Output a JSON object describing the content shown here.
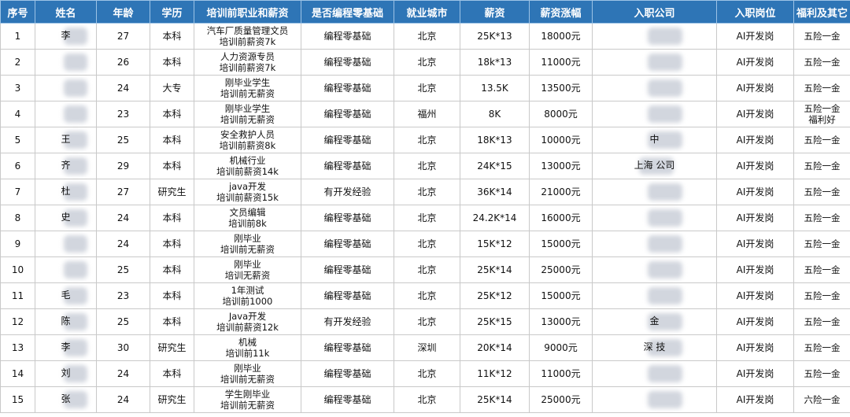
{
  "headers": {
    "index": "序号",
    "name": "姓名",
    "age": "年龄",
    "education": "学历",
    "prev_job": "培训前职业和薪资",
    "zero_base": "是否编程零基础",
    "city": "就业城市",
    "salary": "薪资",
    "raise": "薪资涨幅",
    "company": "入职公司",
    "position": "入职岗位",
    "benefits": "福利及其它"
  },
  "rows": [
    {
      "index": "1",
      "name": "李",
      "age": "27",
      "education": "本科",
      "prev_job": [
        "汽车厂质量管理文员",
        "培训前薪资7k"
      ],
      "zero_base": "编程零基础",
      "city": "北京",
      "salary": "25K*13",
      "raise": "18000元",
      "company": "",
      "position": "AI开发岗",
      "benefits": [
        "五险一金"
      ]
    },
    {
      "index": "2",
      "name": "",
      "age": "26",
      "education": "本科",
      "prev_job": [
        "人力资源专员",
        "培训前薪资7k"
      ],
      "zero_base": "编程零基础",
      "city": "北京",
      "salary": "18k*13",
      "raise": "11000元",
      "company": "",
      "position": "AI开发岗",
      "benefits": [
        "五险一金"
      ]
    },
    {
      "index": "3",
      "name": "",
      "age": "24",
      "education": "大专",
      "prev_job": [
        "刚毕业学生",
        "培训前无薪资"
      ],
      "zero_base": "编程零基础",
      "city": "北京",
      "salary": "13.5K",
      "raise": "13500元",
      "company": "",
      "position": "AI开发岗",
      "benefits": [
        "五险一金"
      ]
    },
    {
      "index": "4",
      "name": "",
      "age": "23",
      "education": "本科",
      "prev_job": [
        "刚毕业学生",
        "培训前无薪资"
      ],
      "zero_base": "编程零基础",
      "city": "福州",
      "salary": "8K",
      "raise": "8000元",
      "company": "",
      "position": "AI开发岗",
      "benefits": [
        "五险一金",
        "福利好"
      ]
    },
    {
      "index": "5",
      "name": "王",
      "age": "25",
      "education": "本科",
      "prev_job": [
        "安全救护人员",
        "培训前薪资8k"
      ],
      "zero_base": "编程零基础",
      "city": "北京",
      "salary": "18K*13",
      "raise": "10000元",
      "company": "中",
      "position": "AI开发岗",
      "benefits": [
        "五险一金"
      ]
    },
    {
      "index": "6",
      "name": "齐",
      "age": "29",
      "education": "本科",
      "prev_job": [
        "机械行业",
        "培训前薪资14k"
      ],
      "zero_base": "编程零基础",
      "city": "北京",
      "salary": "24K*15",
      "raise": "13000元",
      "company": "上海 公司",
      "position": "AI开发岗",
      "benefits": [
        "五险一金"
      ]
    },
    {
      "index": "7",
      "name": "杜",
      "age": "27",
      "education": "研究生",
      "prev_job": [
        "java开发",
        "培训前薪资15k"
      ],
      "zero_base": "有开发经验",
      "city": "北京",
      "salary": "36K*14",
      "raise": "21000元",
      "company": "",
      "position": "AI开发岗",
      "benefits": [
        "五险一金"
      ]
    },
    {
      "index": "8",
      "name": "史",
      "age": "24",
      "education": "本科",
      "prev_job": [
        "文员编辑",
        "培训前8k"
      ],
      "zero_base": "编程零基础",
      "city": "北京",
      "salary": "24.2K*14",
      "raise": "16000元",
      "company": "",
      "position": "AI开发岗",
      "benefits": [
        "五险一金"
      ]
    },
    {
      "index": "9",
      "name": "",
      "age": "24",
      "education": "本科",
      "prev_job": [
        "刚毕业",
        "培训前无薪资"
      ],
      "zero_base": "编程零基础",
      "city": "北京",
      "salary": "15K*12",
      "raise": "15000元",
      "company": "",
      "position": "AI开发岗",
      "benefits": [
        "五险一金"
      ]
    },
    {
      "index": "10",
      "name": "",
      "age": "25",
      "education": "本科",
      "prev_job": [
        "刚毕业",
        "培训无薪资"
      ],
      "zero_base": "编程零基础",
      "city": "北京",
      "salary": "25K*14",
      "raise": "25000元",
      "company": "",
      "position": "AI开发岗",
      "benefits": [
        "五险一金"
      ]
    },
    {
      "index": "11",
      "name": "毛",
      "age": "23",
      "education": "本科",
      "prev_job": [
        "1年测试",
        "培训前1000"
      ],
      "zero_base": "编程零基础",
      "city": "北京",
      "salary": "25K*12",
      "raise": "15000元",
      "company": "",
      "position": "AI开发岗",
      "benefits": [
        "五险一金"
      ]
    },
    {
      "index": "12",
      "name": "陈",
      "age": "25",
      "education": "本科",
      "prev_job": [
        "Java开发",
        "培训前薪资12k"
      ],
      "zero_base": "有开发经验",
      "city": "北京",
      "salary": "25K*15",
      "raise": "13000元",
      "company": "金",
      "position": "AI开发岗",
      "benefits": [
        "五险一金"
      ]
    },
    {
      "index": "13",
      "name": "李",
      "age": "30",
      "education": "研究生",
      "prev_job": [
        "机械",
        "培训前11k"
      ],
      "zero_base": "编程零基础",
      "city": "深圳",
      "salary": "20K*14",
      "raise": "9000元",
      "company": "深 技",
      "position": "AI开发岗",
      "benefits": [
        "五险一金"
      ]
    },
    {
      "index": "14",
      "name": "刘",
      "age": "24",
      "education": "本科",
      "prev_job": [
        "刚毕业",
        "培训前无薪资"
      ],
      "zero_base": "编程零基础",
      "city": "北京",
      "salary": "11K*12",
      "raise": "11000元",
      "company": "",
      "position": "AI开发岗",
      "benefits": [
        "五险一金"
      ]
    },
    {
      "index": "15",
      "name": "张",
      "age": "24",
      "education": "研究生",
      "prev_job": [
        "学生刚毕业",
        "培训前无薪资"
      ],
      "zero_base": "编程零基础",
      "city": "北京",
      "salary": "25K*14",
      "raise": "25000元",
      "company": "",
      "position": "AI开发岗",
      "benefits": [
        "六险一金"
      ]
    }
  ]
}
